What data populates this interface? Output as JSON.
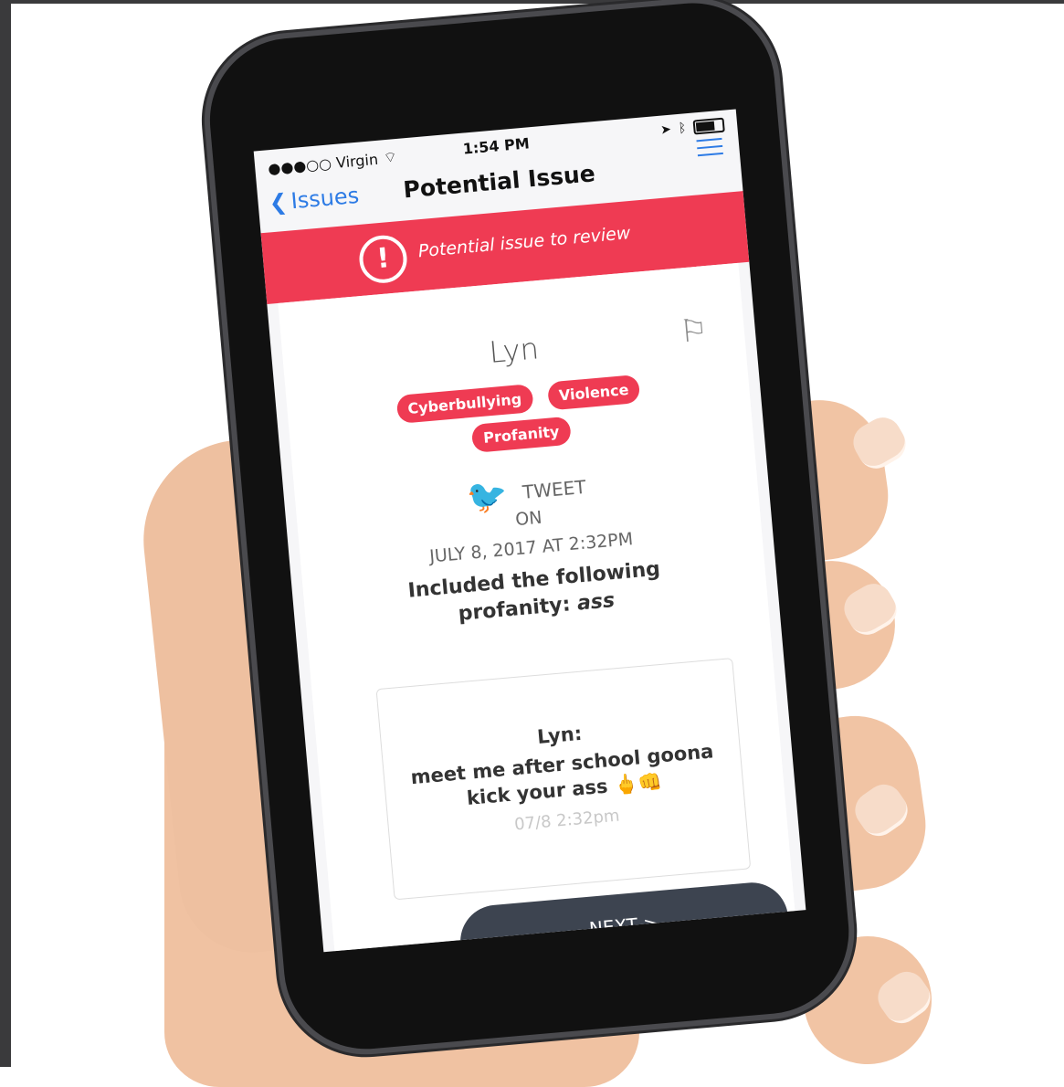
{
  "status": {
    "carrier": "●●●○○ Virgin",
    "time": "1:54 PM"
  },
  "nav": {
    "back_label": "Issues",
    "title": "Potential Issue"
  },
  "banner": {
    "text": "Potential issue to review",
    "icon": "alert-circle-icon"
  },
  "issue": {
    "name": "Lyn",
    "tags": [
      "Cyberbullying",
      "Violence",
      "Profanity"
    ],
    "source": "TWEET",
    "on": "ON",
    "date": "JULY 8, 2017 AT 2:32PM",
    "description_prefix": "Included the following profanity:",
    "description_word": "ass"
  },
  "message": {
    "author": "Lyn:",
    "text": "meet me after school goona kick your ass 🖕👊",
    "time": "07/8 2:32pm"
  },
  "next_label": "NEXT >",
  "colors": {
    "accent_red": "#ef3b53",
    "ios_blue": "#2d7be5",
    "button_dark": "#3d4450"
  }
}
